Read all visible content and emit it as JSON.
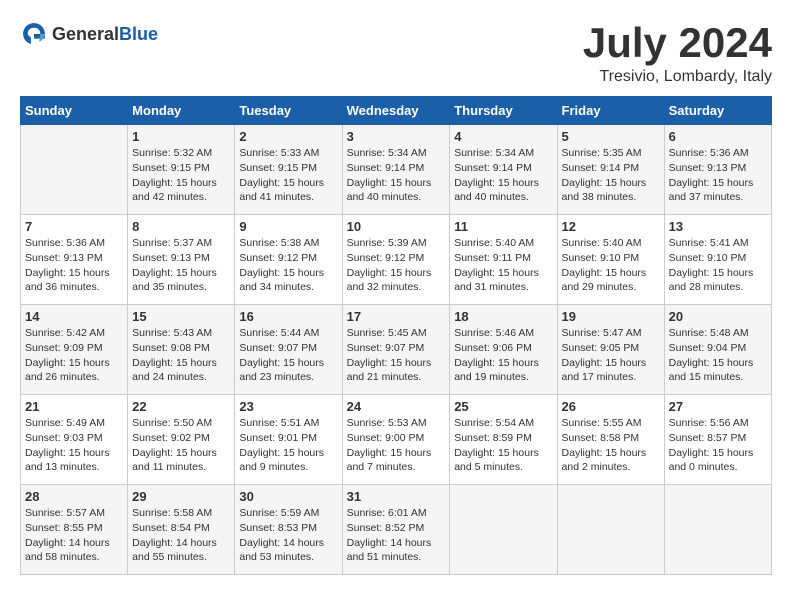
{
  "header": {
    "logo_general": "General",
    "logo_blue": "Blue",
    "month_year": "July 2024",
    "location": "Tresivio, Lombardy, Italy"
  },
  "days_of_week": [
    "Sunday",
    "Monday",
    "Tuesday",
    "Wednesday",
    "Thursday",
    "Friday",
    "Saturday"
  ],
  "weeks": [
    [
      {
        "date": "",
        "text": ""
      },
      {
        "date": "1",
        "text": "Sunrise: 5:32 AM\nSunset: 9:15 PM\nDaylight: 15 hours\nand 42 minutes."
      },
      {
        "date": "2",
        "text": "Sunrise: 5:33 AM\nSunset: 9:15 PM\nDaylight: 15 hours\nand 41 minutes."
      },
      {
        "date": "3",
        "text": "Sunrise: 5:34 AM\nSunset: 9:14 PM\nDaylight: 15 hours\nand 40 minutes."
      },
      {
        "date": "4",
        "text": "Sunrise: 5:34 AM\nSunset: 9:14 PM\nDaylight: 15 hours\nand 40 minutes."
      },
      {
        "date": "5",
        "text": "Sunrise: 5:35 AM\nSunset: 9:14 PM\nDaylight: 15 hours\nand 38 minutes."
      },
      {
        "date": "6",
        "text": "Sunrise: 5:36 AM\nSunset: 9:13 PM\nDaylight: 15 hours\nand 37 minutes."
      }
    ],
    [
      {
        "date": "7",
        "text": "Sunrise: 5:36 AM\nSunset: 9:13 PM\nDaylight: 15 hours\nand 36 minutes."
      },
      {
        "date": "8",
        "text": "Sunrise: 5:37 AM\nSunset: 9:13 PM\nDaylight: 15 hours\nand 35 minutes."
      },
      {
        "date": "9",
        "text": "Sunrise: 5:38 AM\nSunset: 9:12 PM\nDaylight: 15 hours\nand 34 minutes."
      },
      {
        "date": "10",
        "text": "Sunrise: 5:39 AM\nSunset: 9:12 PM\nDaylight: 15 hours\nand 32 minutes."
      },
      {
        "date": "11",
        "text": "Sunrise: 5:40 AM\nSunset: 9:11 PM\nDaylight: 15 hours\nand 31 minutes."
      },
      {
        "date": "12",
        "text": "Sunrise: 5:40 AM\nSunset: 9:10 PM\nDaylight: 15 hours\nand 29 minutes."
      },
      {
        "date": "13",
        "text": "Sunrise: 5:41 AM\nSunset: 9:10 PM\nDaylight: 15 hours\nand 28 minutes."
      }
    ],
    [
      {
        "date": "14",
        "text": "Sunrise: 5:42 AM\nSunset: 9:09 PM\nDaylight: 15 hours\nand 26 minutes."
      },
      {
        "date": "15",
        "text": "Sunrise: 5:43 AM\nSunset: 9:08 PM\nDaylight: 15 hours\nand 24 minutes."
      },
      {
        "date": "16",
        "text": "Sunrise: 5:44 AM\nSunset: 9:07 PM\nDaylight: 15 hours\nand 23 minutes."
      },
      {
        "date": "17",
        "text": "Sunrise: 5:45 AM\nSunset: 9:07 PM\nDaylight: 15 hours\nand 21 minutes."
      },
      {
        "date": "18",
        "text": "Sunrise: 5:46 AM\nSunset: 9:06 PM\nDaylight: 15 hours\nand 19 minutes."
      },
      {
        "date": "19",
        "text": "Sunrise: 5:47 AM\nSunset: 9:05 PM\nDaylight: 15 hours\nand 17 minutes."
      },
      {
        "date": "20",
        "text": "Sunrise: 5:48 AM\nSunset: 9:04 PM\nDaylight: 15 hours\nand 15 minutes."
      }
    ],
    [
      {
        "date": "21",
        "text": "Sunrise: 5:49 AM\nSunset: 9:03 PM\nDaylight: 15 hours\nand 13 minutes."
      },
      {
        "date": "22",
        "text": "Sunrise: 5:50 AM\nSunset: 9:02 PM\nDaylight: 15 hours\nand 11 minutes."
      },
      {
        "date": "23",
        "text": "Sunrise: 5:51 AM\nSunset: 9:01 PM\nDaylight: 15 hours\nand 9 minutes."
      },
      {
        "date": "24",
        "text": "Sunrise: 5:53 AM\nSunset: 9:00 PM\nDaylight: 15 hours\nand 7 minutes."
      },
      {
        "date": "25",
        "text": "Sunrise: 5:54 AM\nSunset: 8:59 PM\nDaylight: 15 hours\nand 5 minutes."
      },
      {
        "date": "26",
        "text": "Sunrise: 5:55 AM\nSunset: 8:58 PM\nDaylight: 15 hours\nand 2 minutes."
      },
      {
        "date": "27",
        "text": "Sunrise: 5:56 AM\nSunset: 8:57 PM\nDaylight: 15 hours\nand 0 minutes."
      }
    ],
    [
      {
        "date": "28",
        "text": "Sunrise: 5:57 AM\nSunset: 8:55 PM\nDaylight: 14 hours\nand 58 minutes."
      },
      {
        "date": "29",
        "text": "Sunrise: 5:58 AM\nSunset: 8:54 PM\nDaylight: 14 hours\nand 55 minutes."
      },
      {
        "date": "30",
        "text": "Sunrise: 5:59 AM\nSunset: 8:53 PM\nDaylight: 14 hours\nand 53 minutes."
      },
      {
        "date": "31",
        "text": "Sunrise: 6:01 AM\nSunset: 8:52 PM\nDaylight: 14 hours\nand 51 minutes."
      },
      {
        "date": "",
        "text": ""
      },
      {
        "date": "",
        "text": ""
      },
      {
        "date": "",
        "text": ""
      }
    ]
  ]
}
